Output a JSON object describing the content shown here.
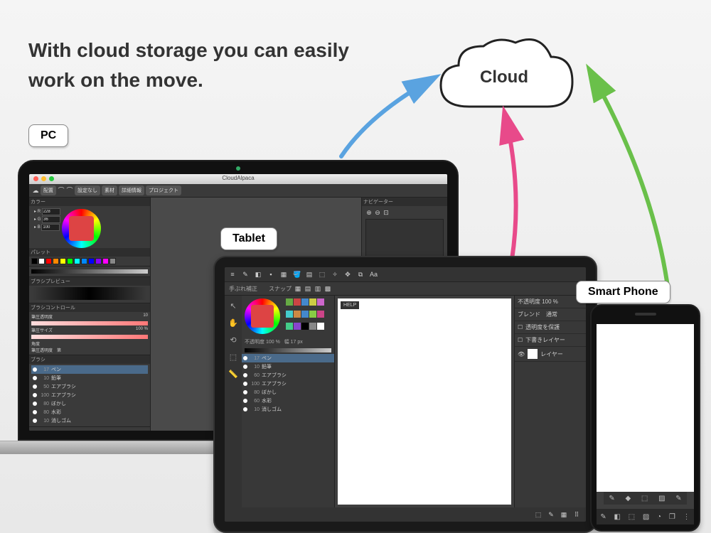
{
  "headline_l1": "With cloud storage you can easily",
  "headline_l2": " work on the move.",
  "cloud_label": "Cloud",
  "labels": {
    "pc": "PC",
    "tablet": "Tablet",
    "phone": "Smart Phone"
  },
  "pc_app": {
    "title": "CloudAlpaca",
    "toolbar": {
      "arrange": "配置",
      "setting": "設定なし",
      "material": "素材",
      "info": "詳細情報",
      "project": "プロジェクト"
    },
    "panels": {
      "color": "カラー",
      "palette": "パレット",
      "brush_preview": "ブラシプレビュー",
      "brush_control": "ブラシコントロール",
      "brush": "ブラシ",
      "navigator": "ナビゲーター"
    },
    "rgb": {
      "r": "R",
      "g": "G",
      "b": "B",
      "r_v": "228",
      "g_v": "36",
      "b_v": "100"
    },
    "ctrl": {
      "opacity": "筆圧透明度",
      "opacity_v": "10",
      "size": "筆圧サイズ",
      "size_v": "100 %",
      "angle": "角度",
      "soft": "筆圧透明度　第"
    },
    "brushes": [
      {
        "sz": "17",
        "name": "ペン"
      },
      {
        "sz": "10",
        "name": "鉛筆"
      },
      {
        "sz": "50",
        "name": "エアブラシ"
      },
      {
        "sz": "100",
        "name": "エアブラシ"
      },
      {
        "sz": "80",
        "name": "ぼかし"
      },
      {
        "sz": "80",
        "name": "水彩"
      },
      {
        "sz": "10",
        "name": "消しゴム"
      }
    ]
  },
  "tablet_app": {
    "correction": "手ぶれ補正",
    "snap": "スナップ",
    "help": "HELP",
    "opacity_label": "不透明度 100 %",
    "width_label": "幅 17 px",
    "right": {
      "opacity": "不透明度 100 %",
      "blend": "ブレンド　通常",
      "protect": "透明度を保護",
      "draft": "下書きレイヤー",
      "layer": "レイヤー"
    },
    "brushes": [
      {
        "sz": "17",
        "name": "ペン"
      },
      {
        "sz": "10",
        "name": "鉛筆"
      },
      {
        "sz": "60",
        "name": "エアブラシ"
      },
      {
        "sz": "100",
        "name": "エアブラシ"
      },
      {
        "sz": "80",
        "name": "ぼかし"
      },
      {
        "sz": "60",
        "name": "水彩"
      },
      {
        "sz": "10",
        "name": "消しゴム"
      }
    ]
  },
  "colors": {
    "swatches": [
      "#000",
      "#fff",
      "#f00",
      "#f80",
      "#ff0",
      "#0f0",
      "#0ff",
      "#08f",
      "#00f",
      "#80f",
      "#f0f",
      "#888"
    ],
    "palette": [
      "#6a4",
      "#c44",
      "#48c",
      "#cc4",
      "#c6c",
      "#4cc",
      "#c84",
      "#48c",
      "#8c4",
      "#c48",
      "#4c8",
      "#84c",
      "#000",
      "#888",
      "#fff"
    ]
  }
}
